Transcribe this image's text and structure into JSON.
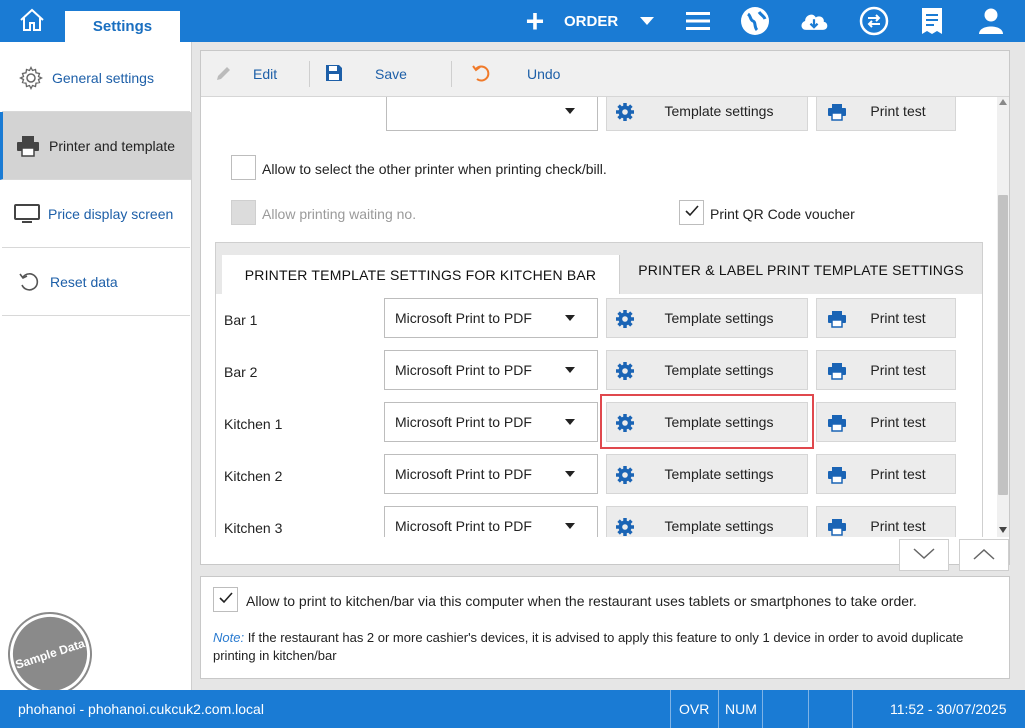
{
  "header": {
    "settings_tab": "Settings",
    "order_label": "ORDER",
    "icons": [
      "home-icon",
      "add-icon",
      "menu-icon",
      "globe-icon",
      "cloud-download-icon",
      "sync-icon",
      "receipt-icon",
      "user-icon"
    ]
  },
  "sidebar": {
    "items": [
      {
        "label": "General settings",
        "icon": "gear-icon"
      },
      {
        "label": "Printer and template",
        "icon": "printer-icon"
      },
      {
        "label": "Price display screen",
        "icon": "monitor-icon"
      },
      {
        "label": "Reset data",
        "icon": "reset-icon"
      }
    ],
    "active_index": 1,
    "stamp": "Sample Data"
  },
  "toolbar": {
    "edit_label": "Edit",
    "save_label": "Save",
    "undo_label": "Undo"
  },
  "top_section": {
    "printer_value": "",
    "template_settings_label": "Template settings",
    "print_test_label": "Print test",
    "allow_select_other_printer": {
      "label": "Allow to select the other printer when printing check/bill.",
      "checked": false
    },
    "allow_waiting_no": {
      "label": "Allow printing waiting no.",
      "checked": false,
      "disabled": true
    },
    "print_qr_voucher": {
      "label": "Print QR Code voucher",
      "checked": true
    }
  },
  "tabs": [
    {
      "label": "PRINTER  TEMPLATE SETTINGS FOR KITCHEN  BAR",
      "active": true
    },
    {
      "label": "PRINTER & LABEL PRINT TEMPLATE SETTINGS",
      "active": false
    }
  ],
  "kitchen_rows": [
    {
      "name": "Bar 1",
      "printer": "Microsoft Print to PDF",
      "template_label": "Template settings",
      "test_label": "Print test"
    },
    {
      "name": "Bar 2",
      "printer": "Microsoft Print to PDF",
      "template_label": "Template settings",
      "test_label": "Print test"
    },
    {
      "name": "Kitchen 1",
      "printer": "Microsoft Print to PDF",
      "template_label": "Template settings",
      "test_label": "Print test",
      "highlighted": true
    },
    {
      "name": "Kitchen 2",
      "printer": "Microsoft Print to PDF",
      "template_label": "Template settings",
      "test_label": "Print test"
    },
    {
      "name": "Kitchen 3",
      "printer": "Microsoft Print to PDF",
      "template_label": "Template settings",
      "test_label": "Print test"
    }
  ],
  "bottom": {
    "allow_kitchen_print": {
      "label": "Allow to print to kitchen/bar via this computer when the restaurant uses tablets or smartphones to take order.",
      "checked": true
    },
    "note_prefix": "Note:",
    "note_text": " If the restaurant has 2 or more cashier's devices, it is advised to apply this feature to only 1 device in order to avoid duplicate printing in kitchen/bar"
  },
  "statusbar": {
    "site": "phohanoi - phohanoi.cukcuk2.com.local",
    "ovr": "OVR",
    "num": "NUM",
    "datetime": "11:52 - 30/07/2025"
  },
  "colors": {
    "brand_blue": "#1a7bd4",
    "link_blue": "#1d5fa8",
    "highlight_red": "#e0484d"
  }
}
